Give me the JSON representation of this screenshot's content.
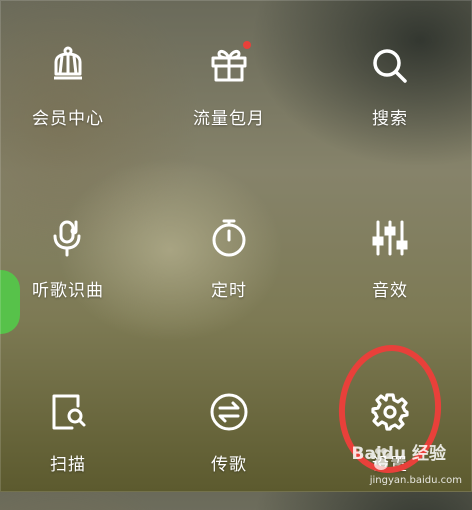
{
  "menu": {
    "items": [
      {
        "label": "会员中心",
        "icon": "crown-icon"
      },
      {
        "label": "流量包月",
        "icon": "gift-icon",
        "badge": "red-dot"
      },
      {
        "label": "搜索",
        "icon": "search-icon"
      },
      {
        "label": "听歌识曲",
        "icon": "mic-music-icon"
      },
      {
        "label": "定时",
        "icon": "timer-icon"
      },
      {
        "label": "音效",
        "icon": "equalizer-icon"
      },
      {
        "label": "扫描",
        "icon": "scan-phone-icon"
      },
      {
        "label": "传歌",
        "icon": "transfer-icon"
      },
      {
        "label": "设置",
        "icon": "gear-icon"
      }
    ]
  },
  "annotation": {
    "color": "#e8403a",
    "target": "设置"
  },
  "watermark": {
    "brand": "Baidu 经验",
    "url": "jingyan.baidu.com"
  },
  "colors": {
    "text": "#ffffff",
    "badge": "#e8403a",
    "side_tab": "#57c24a"
  }
}
